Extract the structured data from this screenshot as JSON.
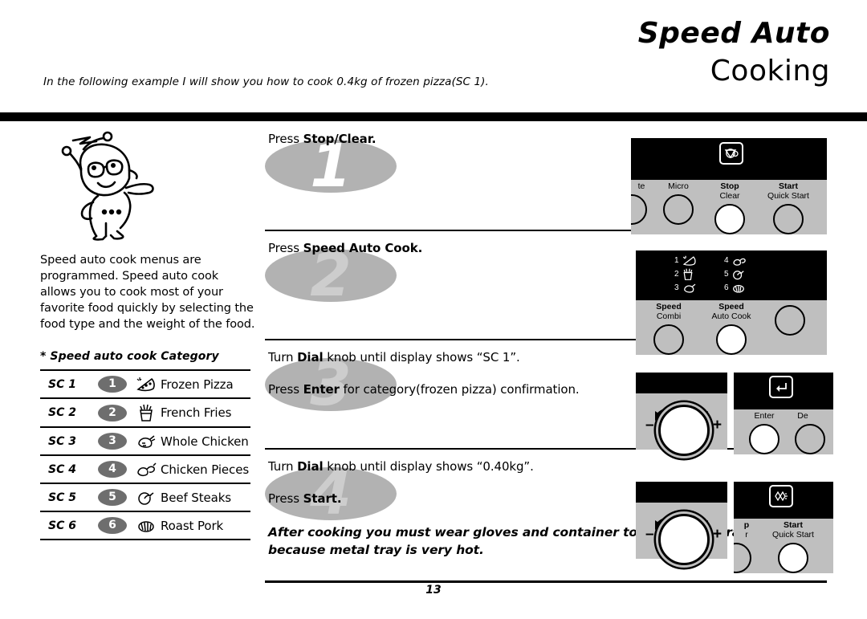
{
  "header": {
    "title_line_1": "Speed Auto",
    "title_line_2": "Cooking",
    "intro": "In the following example I will show you how to cook 0.4kg of frozen pizza(SC 1)."
  },
  "left": {
    "mascot_icon": "chef-mascot-icon",
    "blurb": "Speed auto cook menus are programmed. Speed auto cook allows you to cook most of your favorite food quickly by selecting the food type and the weight of the food.",
    "category_title": "* Speed auto cook Category",
    "categories": [
      {
        "code": "SC 1",
        "number": "1",
        "icon": "pizza-icon",
        "label": "Frozen Pizza"
      },
      {
        "code": "SC 2",
        "number": "2",
        "icon": "fries-icon",
        "label": "French Fries"
      },
      {
        "code": "SC 3",
        "number": "3",
        "icon": "whole-chicken-icon",
        "label": "Whole Chicken"
      },
      {
        "code": "SC 4",
        "number": "4",
        "icon": "chicken-pieces-icon",
        "label": "Chicken Pieces"
      },
      {
        "code": "SC 5",
        "number": "5",
        "icon": "beef-steak-icon",
        "label": "Beef Steaks"
      },
      {
        "code": "SC 6",
        "number": "6",
        "icon": "roast-pork-icon",
        "label": "Roast Pork"
      }
    ]
  },
  "steps": [
    {
      "number": "1",
      "lines": [
        {
          "prefix": "Press ",
          "bold": "Stop/Clear.",
          "suffix": ""
        }
      ]
    },
    {
      "number": "2",
      "lines": [
        {
          "prefix": "Press ",
          "bold": "Speed Auto Cook.",
          "suffix": ""
        }
      ]
    },
    {
      "number": "3",
      "lines": [
        {
          "prefix": "Turn ",
          "bold": "Dial",
          "suffix": " knob until display shows “SC 1”."
        },
        {
          "prefix": "Press ",
          "bold": "Enter",
          "suffix": " for category(frozen pizza) confirmation."
        }
      ]
    },
    {
      "number": "4",
      "lines": [
        {
          "prefix": "Turn ",
          "bold": "Dial",
          "suffix": " knob until display shows “0.40kg”."
        },
        {
          "prefix": "Press ",
          "bold": "Start.",
          "suffix": ""
        }
      ],
      "warning": "After cooking you must wear gloves and container to take metal tray out oven, because metal tray is very hot."
    }
  ],
  "panels": {
    "panel1": {
      "display_glyph_icon": "microwave-plate-icon",
      "buttons": [
        {
          "line1": "",
          "line2": "te",
          "lit": false,
          "name": "plate-button-cropped"
        },
        {
          "line1": "",
          "line2": "Micro",
          "lit": false,
          "name": "micro-button"
        },
        {
          "line1": "Stop",
          "line2": "Clear",
          "lit": true,
          "name": "stop-clear-button"
        },
        {
          "line1": "Start",
          "line2": "Quick Start",
          "lit": false,
          "name": "start-quick-start-button"
        }
      ]
    },
    "panel2": {
      "display_foods_left": [
        {
          "num": "1",
          "icon": "pizza-icon"
        },
        {
          "num": "2",
          "icon": "fries-icon"
        },
        {
          "num": "3",
          "icon": "whole-chicken-icon"
        }
      ],
      "display_foods_right": [
        {
          "num": "4",
          "icon": "chicken-pieces-icon"
        },
        {
          "num": "5",
          "icon": "beef-steak-icon"
        },
        {
          "num": "6",
          "icon": "roast-pork-icon"
        }
      ],
      "buttons": [
        {
          "line1": "Speed",
          "line2": "Combi",
          "lit": false,
          "name": "speed-combi-button"
        },
        {
          "line1": "Speed",
          "line2": "Auto Cook",
          "lit": true,
          "name": "speed-auto-cook-button"
        },
        {
          "line1": "",
          "line2": "",
          "lit": false,
          "name": "unlabeled-button"
        }
      ]
    },
    "panel3": {
      "dial": {
        "minus": "–",
        "plus": "+",
        "name": "dial-knob"
      },
      "display_glyph_icon": "enter-arrow-icon",
      "buttons": [
        {
          "line1": "",
          "line2": "Enter",
          "lit": true,
          "name": "enter-button"
        },
        {
          "line1": "",
          "line2": "De",
          "lit": false,
          "name": "defrost-button-cropped"
        }
      ]
    },
    "panel4": {
      "dial": {
        "minus": "–",
        "plus": "+",
        "name": "dial-knob"
      },
      "display_glyph_icon": "speed-cook-icon",
      "buttons": [
        {
          "line1": "p",
          "line2": "r",
          "lit": false,
          "name": "stop-clear-button-cropped"
        },
        {
          "line1": "Start",
          "line2": "Quick Start",
          "lit": true,
          "name": "start-quick-start-button"
        }
      ]
    }
  },
  "footer": {
    "page_number": "13"
  }
}
